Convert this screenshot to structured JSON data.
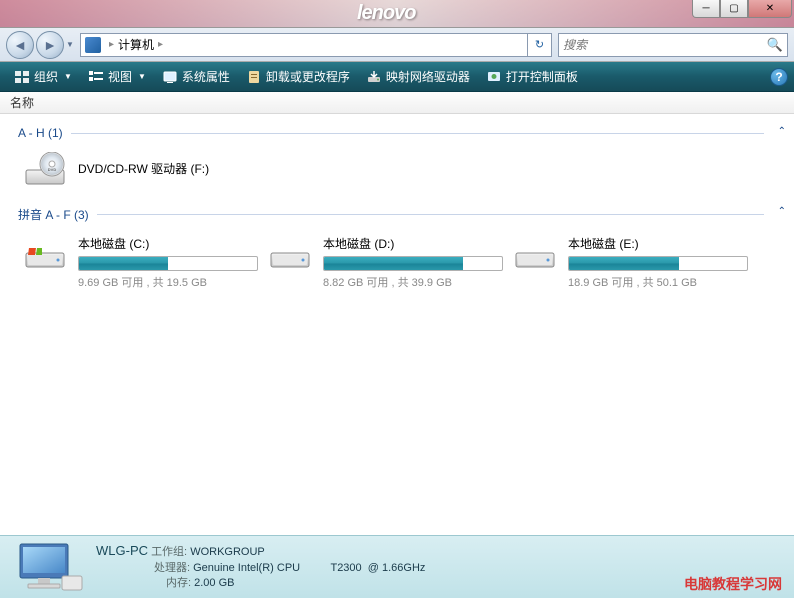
{
  "titlebar": {
    "logo": "lenovo"
  },
  "navbar": {
    "breadcrumb": [
      "计算机"
    ],
    "search_placeholder": "搜索"
  },
  "toolbar": {
    "organize": "组织",
    "view": "视图",
    "properties": "系统属性",
    "uninstall": "卸载或更改程序",
    "map_drive": "映射网络驱动器",
    "control_panel": "打开控制面板"
  },
  "column_header": {
    "name": "名称"
  },
  "groups": [
    {
      "title": "A - H (1)",
      "items": [
        {
          "name": "DVD/CD-RW 驱动器 (F:)",
          "type": "dvd"
        }
      ]
    },
    {
      "title": "拼音 A - F (3)",
      "items": [
        {
          "name": "本地磁盘 (C:)",
          "type": "system",
          "free": "9.69 GB",
          "total": "19.5 GB",
          "stats": "9.69 GB 可用 , 共 19.5 GB",
          "pct": 50
        },
        {
          "name": "本地磁盘 (D:)",
          "type": "hdd",
          "free": "8.82 GB",
          "total": "39.9 GB",
          "stats": "8.82 GB 可用 , 共 39.9 GB",
          "pct": 78
        },
        {
          "name": "本地磁盘 (E:)",
          "type": "hdd",
          "free": "18.9 GB",
          "total": "50.1 GB",
          "stats": "18.9 GB 可用 , 共 50.1 GB",
          "pct": 62
        }
      ]
    }
  ],
  "details": {
    "computer_name": "WLG-PC",
    "workgroup_label": "工作组:",
    "workgroup": "WORKGROUP",
    "cpu_label": "处理器:",
    "cpu": "Genuine Intel(R) CPU          T2300  @ 1.66GHz",
    "mem_label": "内存:",
    "mem": "2.00 GB"
  },
  "watermark": "电脑教程学习网"
}
